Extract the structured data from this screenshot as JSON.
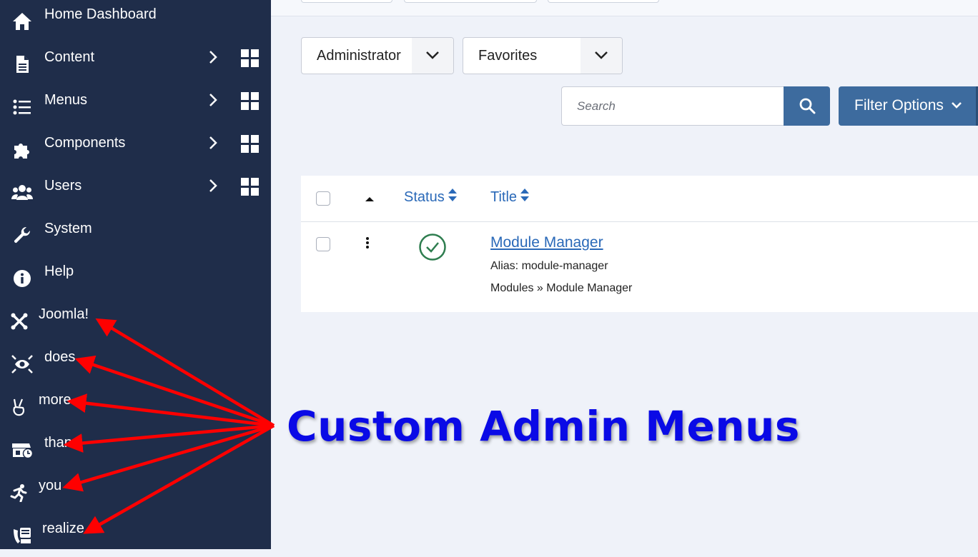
{
  "sidebar": {
    "items": [
      {
        "label": "Home Dashboard",
        "icon": "home-icon",
        "has_submenu": false
      },
      {
        "label": "Content",
        "icon": "file-icon",
        "has_submenu": true
      },
      {
        "label": "Menus",
        "icon": "list-icon",
        "has_submenu": true
      },
      {
        "label": "Components",
        "icon": "puzzle-icon",
        "has_submenu": true
      },
      {
        "label": "Users",
        "icon": "users-icon",
        "has_submenu": true
      },
      {
        "label": "System",
        "icon": "wrench-icon",
        "has_submenu": false
      },
      {
        "label": "Help",
        "icon": "info-icon",
        "has_submenu": false
      },
      {
        "label": "Joomla!",
        "icon": "joomla-icon",
        "has_submenu": false
      },
      {
        "label": "does",
        "icon": "eye-arrows-icon",
        "has_submenu": false
      },
      {
        "label": "more",
        "icon": "peace-hand-icon",
        "has_submenu": false
      },
      {
        "label": "than",
        "icon": "shop-clock-icon",
        "has_submenu": false
      },
      {
        "label": "you",
        "icon": "running-person-icon",
        "has_submenu": false
      },
      {
        "label": "realize",
        "icon": "reception-icon",
        "has_submenu": false
      }
    ]
  },
  "filters": {
    "client_select": "Administrator",
    "menu_select": "Favorites",
    "search_placeholder": "Search",
    "filter_options_label": "Filter Options"
  },
  "table": {
    "headers": {
      "status": "Status",
      "title": "Title"
    },
    "rows": [
      {
        "title": "Module Manager",
        "alias": "Alias: module-manager",
        "path": "Modules » Module Manager",
        "status": "published"
      }
    ]
  },
  "annotation": {
    "title": "Custom Admin Menus",
    "color": "#0a0ae6",
    "arrow_color": "#ff0000"
  },
  "colors": {
    "sidebar_bg": "#1f2d4a",
    "accent": "#3d6b9e",
    "link": "#2a69b8",
    "success": "#2e7d4f"
  }
}
